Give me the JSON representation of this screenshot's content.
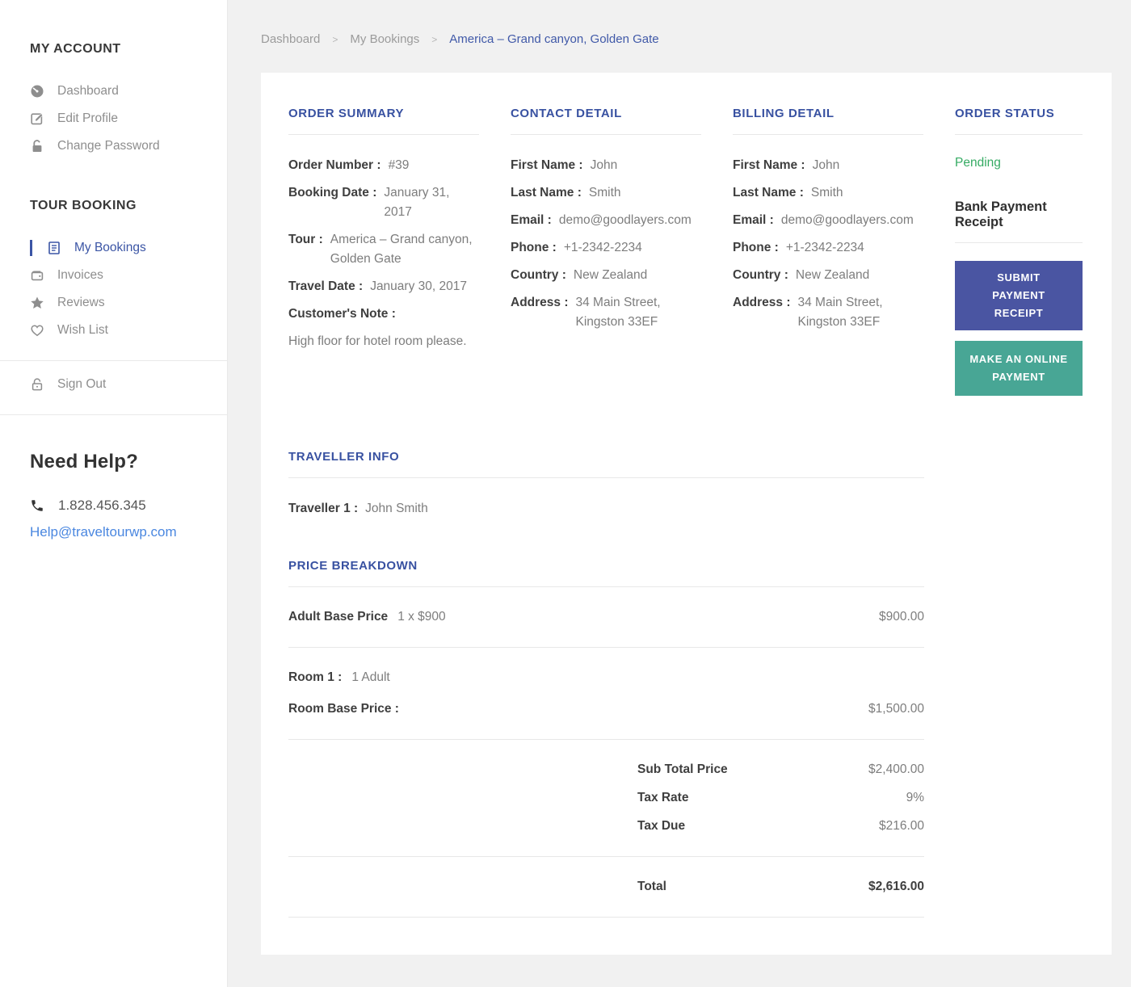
{
  "breadcrumb": {
    "items": [
      "Dashboard",
      "My Bookings"
    ],
    "current": "America – Grand canyon, Golden Gate",
    "separator": ">"
  },
  "sidebar": {
    "my_account": {
      "title": "MY ACCOUNT",
      "items": [
        {
          "label": "Dashboard",
          "icon": "dashboard-icon"
        },
        {
          "label": "Edit Profile",
          "icon": "edit-icon"
        },
        {
          "label": "Change Password",
          "icon": "unlock-icon"
        }
      ]
    },
    "tour_booking": {
      "title": "TOUR BOOKING",
      "items": [
        {
          "label": "My Bookings",
          "icon": "bookings-icon",
          "active": true
        },
        {
          "label": "Invoices",
          "icon": "wallet-icon",
          "active": false
        },
        {
          "label": "Reviews",
          "icon": "star-icon",
          "active": false
        },
        {
          "label": "Wish List",
          "icon": "heart-icon",
          "active": false
        }
      ]
    },
    "sign_out_label": "Sign Out",
    "help": {
      "title": "Need Help?",
      "phone": "1.828.456.345",
      "email": "Help@traveltourwp.com"
    }
  },
  "order_summary": {
    "title": "ORDER SUMMARY",
    "order_number_label": "Order Number :",
    "order_number": "#39",
    "booking_date_label": "Booking Date :",
    "booking_date": "January 31, 2017",
    "tour_label": "Tour :",
    "tour": "America – Grand canyon, Golden Gate",
    "travel_date_label": "Travel Date :",
    "travel_date": "January 30, 2017",
    "note_label": "Customer's Note :",
    "note": "High floor for hotel room please."
  },
  "contact_detail": {
    "title": "CONTACT DETAIL",
    "rows": [
      {
        "label": "First Name :",
        "value": "John"
      },
      {
        "label": "Last Name :",
        "value": "Smith"
      },
      {
        "label": "Email :",
        "value": "demo@goodlayers.com"
      },
      {
        "label": "Phone :",
        "value": "+1-2342-2234"
      },
      {
        "label": "Country :",
        "value": "New Zealand"
      },
      {
        "label": "Address :",
        "value": "34 Main Street, Kingston 33EF"
      }
    ]
  },
  "billing_detail": {
    "title": "BILLING DETAIL",
    "rows": [
      {
        "label": "First Name :",
        "value": "John"
      },
      {
        "label": "Last Name :",
        "value": "Smith"
      },
      {
        "label": "Email :",
        "value": "demo@goodlayers.com"
      },
      {
        "label": "Phone :",
        "value": "+1-2342-2234"
      },
      {
        "label": "Country :",
        "value": "New Zealand"
      },
      {
        "label": "Address :",
        "value": "34 Main Street, Kingston 33EF"
      }
    ]
  },
  "order_status": {
    "title": "ORDER STATUS",
    "status": "Pending",
    "receipt_heading": "Bank Payment Receipt",
    "submit_button": "SUBMIT PAYMENT RECEIPT",
    "online_button": "MAKE AN ONLINE PAYMENT"
  },
  "traveller_info": {
    "title": "TRAVELLER INFO",
    "traveller_label": "Traveller 1 :",
    "traveller_value": "John Smith"
  },
  "price_breakdown": {
    "title": "PRICE BREAKDOWN",
    "adult": {
      "label": "Adult Base Price",
      "detail": "1 x $900",
      "amount": "$900.00"
    },
    "room": {
      "label": "Room 1 :",
      "detail": "1 Adult",
      "base_label": "Room Base Price :",
      "base_amount": "$1,500.00"
    },
    "totals": [
      {
        "label": "Sub Total Price",
        "amount": "$2,400.00"
      },
      {
        "label": "Tax Rate",
        "amount": "9%"
      },
      {
        "label": "Tax Due",
        "amount": "$216.00"
      }
    ],
    "total_label": "Total",
    "total_amount": "$2,616.00"
  },
  "colors": {
    "accent": "#3851a1",
    "active_nav": "#3b55a5",
    "link": "#4a87e0",
    "pending_green": "#35ab63",
    "button_primary": "#4a55a2",
    "button_secondary": "#48a695"
  }
}
